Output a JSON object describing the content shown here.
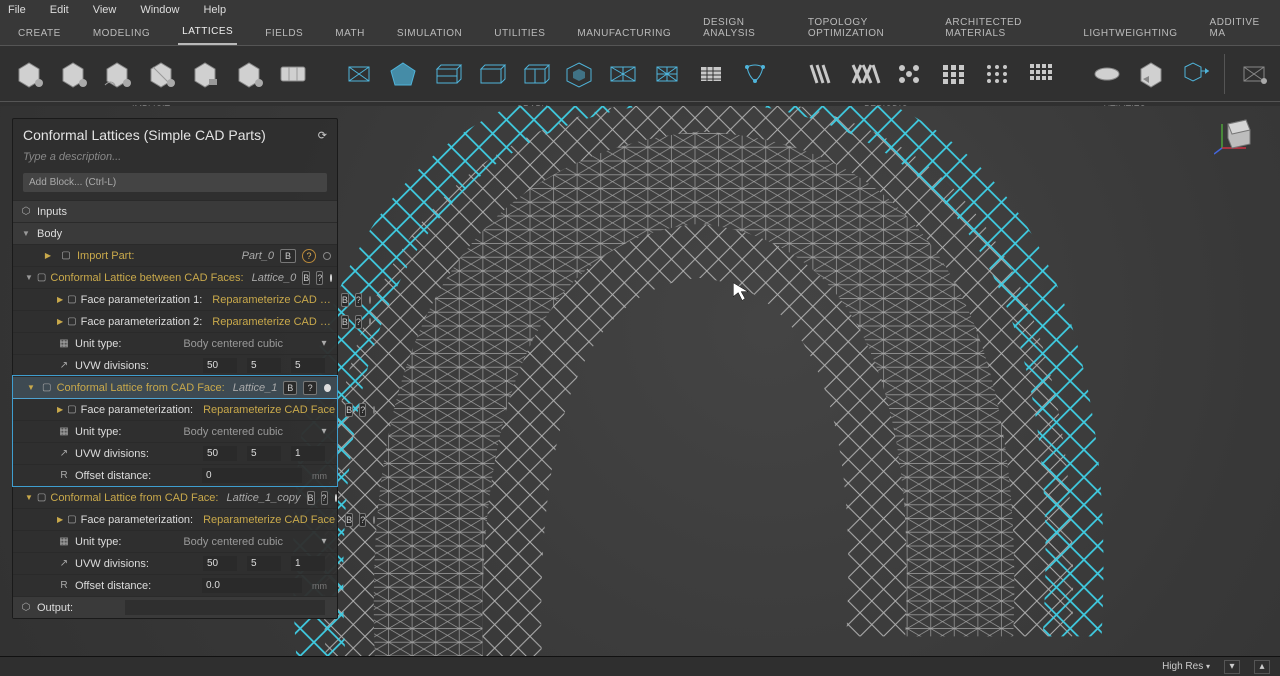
{
  "menu": [
    "File",
    "Edit",
    "View",
    "Window",
    "Help"
  ],
  "tabs": [
    "CREATE",
    "MODELING",
    "LATTICES",
    "FIELDS",
    "MATH",
    "SIMULATION",
    "UTILITIES",
    "MANUFACTURING",
    "DESIGN ANALYSIS",
    "TOPOLOGY OPTIMIZATION",
    "ARCHITECTED MATERIALS",
    "LIGHTWEIGHTING",
    "ADDITIVE MA"
  ],
  "active_tab": "LATTICES",
  "tool_group_labels": {
    "implicit": "IMPLICIT",
    "graph": "GRAPH",
    "periodic": "PERIODIC",
    "utilities": "UTILITIES"
  },
  "panel": {
    "title": "Conformal Lattices (Simple CAD Parts)",
    "description_placeholder": "Type a description...",
    "add_block_placeholder": "Add Block... (Ctrl-L)",
    "inputs_label": "Inputs",
    "body_label": "Body",
    "output_label": "Output:",
    "import": {
      "label": "Import Part:",
      "value": "Part_0",
      "badge": "B"
    },
    "lattice0": {
      "label": "Conformal Lattice between CAD Faces:",
      "value": "Lattice_0",
      "param1_label": "Face parameterization 1:",
      "param2_label": "Face parameterization 2:",
      "param_value": "Reparameterize CAD …",
      "unit_label": "Unit type:",
      "unit_value": "Body centered cubic",
      "uvw_label": "UVW divisions:",
      "uvw": [
        "50",
        "5",
        "5"
      ]
    },
    "lattice1": {
      "label": "Conformal Lattice from CAD Face:",
      "value": "Lattice_1",
      "param_label": "Face parameterization:",
      "param_value": "Reparameterize CAD Face",
      "unit_label": "Unit type:",
      "unit_value": "Body centered cubic",
      "uvw_label": "UVW divisions:",
      "uvw": [
        "50",
        "5",
        "1"
      ],
      "offset_label": "Offset distance:",
      "offset_value": "0",
      "offset_unit": "mm"
    },
    "lattice1_copy": {
      "label": "Conformal Lattice from CAD Face:",
      "value": "Lattice_1_copy",
      "param_label": "Face parameterization:",
      "param_value": "Reparameterize CAD Face",
      "unit_label": "Unit type:",
      "unit_value": "Body centered cubic",
      "uvw_label": "UVW divisions:",
      "uvw": [
        "50",
        "5",
        "1"
      ],
      "offset_label": "Offset distance:",
      "offset_value": "0.0",
      "offset_unit": "mm"
    }
  },
  "status": {
    "quality": "High Res"
  }
}
